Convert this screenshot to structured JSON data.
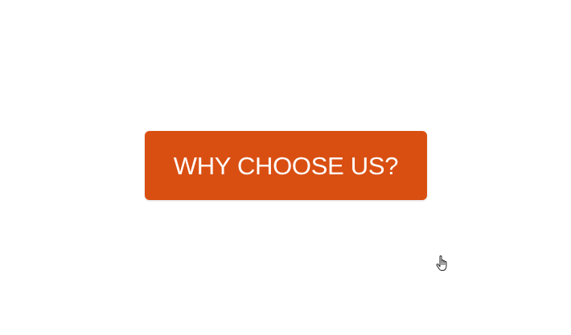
{
  "cta": {
    "label": "WHY CHOOSE US?",
    "background_color": "#d94f12",
    "text_color": "#ffffff"
  },
  "cursor": {
    "icon": "hand-pointer-icon"
  }
}
